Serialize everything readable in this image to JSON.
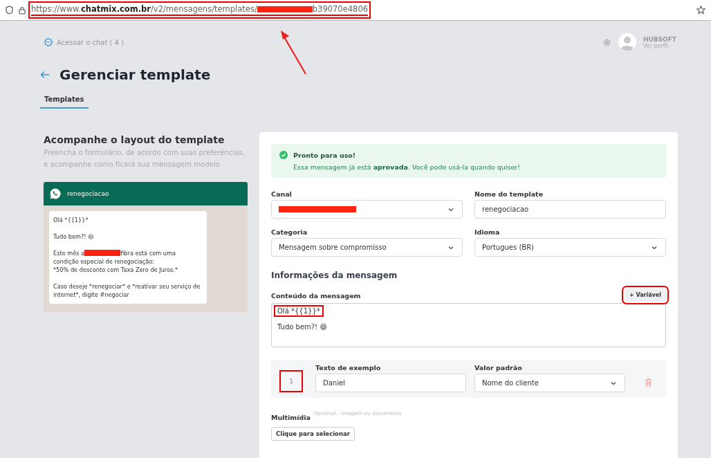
{
  "browser": {
    "url_before": "https://www.**chatmix.com.br**/v2/mensagens/templates/",
    "url_redacted": true,
    "url_after": "b39070e4806",
    "annotated": true
  },
  "header": {
    "chat_link": "Acessar o chat ( 4 )",
    "user_name": "HUBSOFT",
    "user_link": "Ver perfil"
  },
  "page": {
    "title": "Gerenciar template"
  },
  "tabs": [
    {
      "label": "Templates",
      "selected": true
    }
  ],
  "preview": {
    "title": "Acompanhe o layout do template",
    "subtitle": "Preencha o formulário, de acordo com suas preferências, e acompanhe como ficará sua mensagem modelo",
    "chat_name": "renegociacao",
    "paragraphs": [
      {
        "kind": "text",
        "text": "Olá *{{1}}*"
      },
      {
        "kind": "text",
        "text": "Tudo bem?! 😄"
      },
      {
        "kind": "redacted",
        "before": "Este mês a",
        "after": "fibra está com uma condição especial de renegociação:\n*50% de desconto com Taxa Zero de Juros.*"
      },
      {
        "kind": "text",
        "text": "Caso deseje *renegociar* e *reativar seu serviço de internet*, digite #negociar"
      }
    ]
  },
  "alert": {
    "title": "Pronto para uso!",
    "message": "Essa mensagem já está **aprovada**. Você pode usá-la quando quiser!"
  },
  "fields": [
    {
      "label": "Canal",
      "kind": "select",
      "redacted": true
    },
    {
      "label": "Nome do template",
      "kind": "text",
      "value": "renegociacao",
      "redacted": false
    },
    {
      "label": "Categoria",
      "kind": "select",
      "value": "Mensagem sobre compromisso",
      "redacted": false
    },
    {
      "label": "Idioma",
      "kind": "select",
      "value": "Portugues (BR)",
      "redacted": false
    }
  ],
  "message_section": {
    "heading": "Informações da mensagem",
    "content_label": "Conteúdo da mensagem",
    "add_variable_button": "+ Variável",
    "add_variable_annotated": true,
    "lines": [
      {
        "text": "Olá *{{1}}*",
        "annotated": true
      },
      {
        "text": "Tudo bem?! 😄",
        "annotated": false
      }
    ]
  },
  "variables": [
    {
      "number": "1",
      "annotated": true,
      "example_label": "Texto de exemplo",
      "example_value": "Daniel",
      "default_label": "Valor padrão",
      "default_value": "Nome do cliente"
    }
  ],
  "media": {
    "label": "Multimídia",
    "hint": "Opcional - imagem ou documento",
    "button": "Clique para selecionar"
  }
}
